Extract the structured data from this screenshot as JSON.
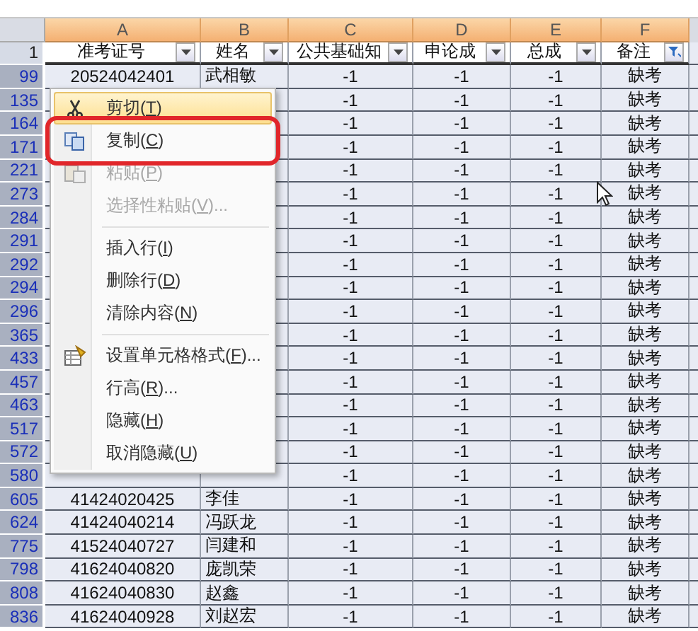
{
  "columns": [
    {
      "letter": "A",
      "header": "准考证号",
      "filtered": false
    },
    {
      "letter": "B",
      "header": "姓名",
      "filtered": false
    },
    {
      "letter": "C",
      "header": "公共基础知",
      "filtered": false
    },
    {
      "letter": "D",
      "header": "申论成",
      "filtered": false
    },
    {
      "letter": "E",
      "header": "总成",
      "filtered": false
    },
    {
      "letter": "F",
      "header": "备注",
      "filtered": true
    }
  ],
  "header_row": "1",
  "rows": [
    {
      "num": "99",
      "id": "20524042401",
      "name": "武相敏",
      "values": [
        "-1",
        "-1",
        "-1",
        "缺考"
      ]
    },
    {
      "num": "135",
      "values": [
        "-1",
        "-1",
        "-1",
        "缺考"
      ]
    },
    {
      "num": "164",
      "values": [
        "-1",
        "-1",
        "-1",
        "缺考"
      ]
    },
    {
      "num": "171",
      "values": [
        "-1",
        "-1",
        "-1",
        "缺考"
      ]
    },
    {
      "num": "221",
      "values": [
        "-1",
        "-1",
        "-1",
        "缺考"
      ]
    },
    {
      "num": "273",
      "values": [
        "-1",
        "-1",
        "-1",
        "缺考"
      ]
    },
    {
      "num": "284",
      "values": [
        "-1",
        "-1",
        "-1",
        "缺考"
      ]
    },
    {
      "num": "291",
      "values": [
        "-1",
        "-1",
        "-1",
        "缺考"
      ]
    },
    {
      "num": "292",
      "values": [
        "-1",
        "-1",
        "-1",
        "缺考"
      ]
    },
    {
      "num": "294",
      "values": [
        "-1",
        "-1",
        "-1",
        "缺考"
      ]
    },
    {
      "num": "296",
      "values": [
        "-1",
        "-1",
        "-1",
        "缺考"
      ]
    },
    {
      "num": "365",
      "values": [
        "-1",
        "-1",
        "-1",
        "缺考"
      ]
    },
    {
      "num": "433",
      "values": [
        "-1",
        "-1",
        "-1",
        "缺考"
      ]
    },
    {
      "num": "457",
      "values": [
        "-1",
        "-1",
        "-1",
        "缺考"
      ]
    },
    {
      "num": "463",
      "values": [
        "-1",
        "-1",
        "-1",
        "缺考"
      ]
    },
    {
      "num": "517",
      "values": [
        "-1",
        "-1",
        "-1",
        "缺考"
      ]
    },
    {
      "num": "572",
      "values": [
        "-1",
        "-1",
        "-1",
        "缺考"
      ]
    },
    {
      "num": "580",
      "values": [
        "-1",
        "-1",
        "-1",
        "缺考"
      ]
    },
    {
      "num": "605",
      "id": "41424020425",
      "name": "李佳",
      "values": [
        "-1",
        "-1",
        "-1",
        "缺考"
      ]
    },
    {
      "num": "624",
      "id": "41424040214",
      "name": "冯跃龙",
      "values": [
        "-1",
        "-1",
        "-1",
        "缺考"
      ]
    },
    {
      "num": "775",
      "id": "41524040727",
      "name": "闫建和",
      "values": [
        "-1",
        "-1",
        "-1",
        "缺考"
      ]
    },
    {
      "num": "798",
      "id": "41624040820",
      "name": "庞凯荣",
      "values": [
        "-1",
        "-1",
        "-1",
        "缺考"
      ]
    },
    {
      "num": "808",
      "id": "41624040830",
      "name": "赵鑫",
      "values": [
        "-1",
        "-1",
        "-1",
        "缺考"
      ]
    },
    {
      "num": "836",
      "id": "41624040928",
      "name": "刘赵宏",
      "values": [
        "-1",
        "-1",
        "-1",
        "缺考"
      ]
    }
  ],
  "context_menu": [
    {
      "kind": "item",
      "before": "剪切(",
      "key": "T",
      "after": ")",
      "disabled": false,
      "selected": true,
      "outlined": false
    },
    {
      "kind": "item",
      "before": "复制(",
      "key": "C",
      "after": ")",
      "disabled": false,
      "selected": false,
      "outlined": true
    },
    {
      "kind": "item",
      "before": "粘贴(",
      "key": "P",
      "after": ")",
      "disabled": true,
      "selected": false,
      "outlined": false
    },
    {
      "kind": "item",
      "before": "选择性粘贴(",
      "key": "V",
      "after": ")...",
      "disabled": true,
      "selected": false,
      "outlined": false
    },
    {
      "kind": "separator"
    },
    {
      "kind": "item",
      "before": "插入行(",
      "key": "I",
      "after": ")",
      "disabled": false,
      "selected": false,
      "outlined": false
    },
    {
      "kind": "item",
      "before": "删除行(",
      "key": "D",
      "after": ")",
      "disabled": false,
      "selected": false,
      "outlined": false
    },
    {
      "kind": "item",
      "before": "清除内容(",
      "key": "N",
      "after": ")",
      "disabled": false,
      "selected": false,
      "outlined": false
    },
    {
      "kind": "separator"
    },
    {
      "kind": "item",
      "before": "设置单元格格式(",
      "key": "F",
      "after": ")...",
      "disabled": false,
      "selected": false,
      "outlined": false
    },
    {
      "kind": "item",
      "before": "行高(",
      "key": "R",
      "after": ")...",
      "disabled": false,
      "selected": false,
      "outlined": false
    },
    {
      "kind": "item",
      "before": "隐藏(",
      "key": "H",
      "after": ")",
      "disabled": false,
      "selected": false,
      "outlined": false
    },
    {
      "kind": "item",
      "before": "取消隐藏(",
      "key": "U",
      "after": ")",
      "disabled": false,
      "selected": false,
      "outlined": false
    }
  ]
}
